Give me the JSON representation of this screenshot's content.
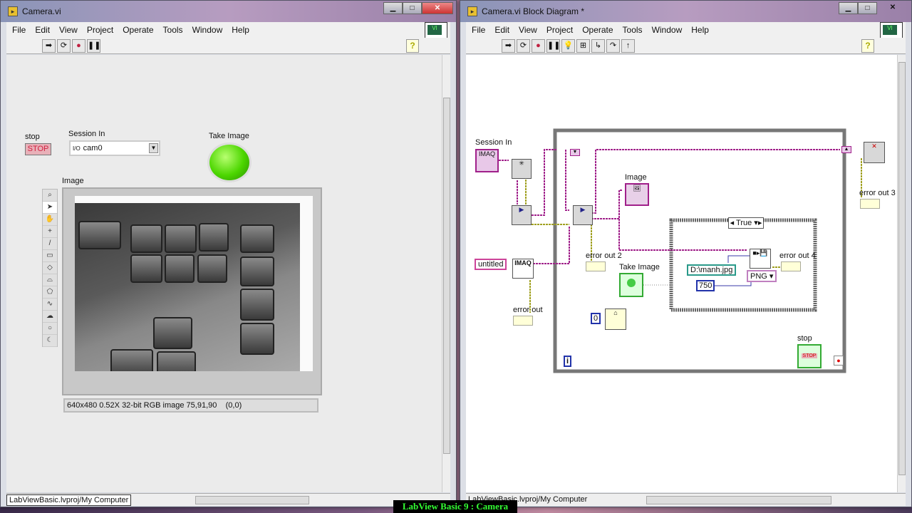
{
  "front": {
    "title": "Camera.vi",
    "menu": [
      "File",
      "Edit",
      "View",
      "Project",
      "Operate",
      "Tools",
      "Window",
      "Help"
    ],
    "stop_label": "stop",
    "stop_button": "STOP",
    "session_label": "Session In",
    "session_value": "cam0",
    "take_image_label": "Take Image",
    "take_image_state": true,
    "image_label": "Image",
    "image_info": "640x480 0.52X 32-bit RGB image 75,91,90",
    "image_coords": "(0,0)",
    "status_path": "LabViewBasic.lvproj/My Computer"
  },
  "diagram": {
    "title": "Camera.vi Block Diagram *",
    "menu": [
      "File",
      "Edit",
      "View",
      "Project",
      "Operate",
      "Tools",
      "Window",
      "Help"
    ],
    "session_in": "Session In",
    "untitled": "untitled",
    "imaq": "IMAQ",
    "image": "Image",
    "error_out": "error out",
    "error_out_2": "error out 2",
    "error_out_3": "error out 3",
    "error_out_4": "error out 4",
    "take_image": "Take Image",
    "case_selector": "True",
    "file_path": "D:\\manh.jpg",
    "format": "PNG",
    "quality": "750",
    "wait_const": "0",
    "loop_index": "i",
    "stop": "stop",
    "stop_btn": "STOP",
    "status_path": "LabViewBasic.lvproj/My Computer"
  },
  "overlay": "LabView Basic 9 : Camera",
  "colors": {
    "wire_image": "#a0208a",
    "wire_error": "#a0a020",
    "led_on": "#4cd600"
  }
}
